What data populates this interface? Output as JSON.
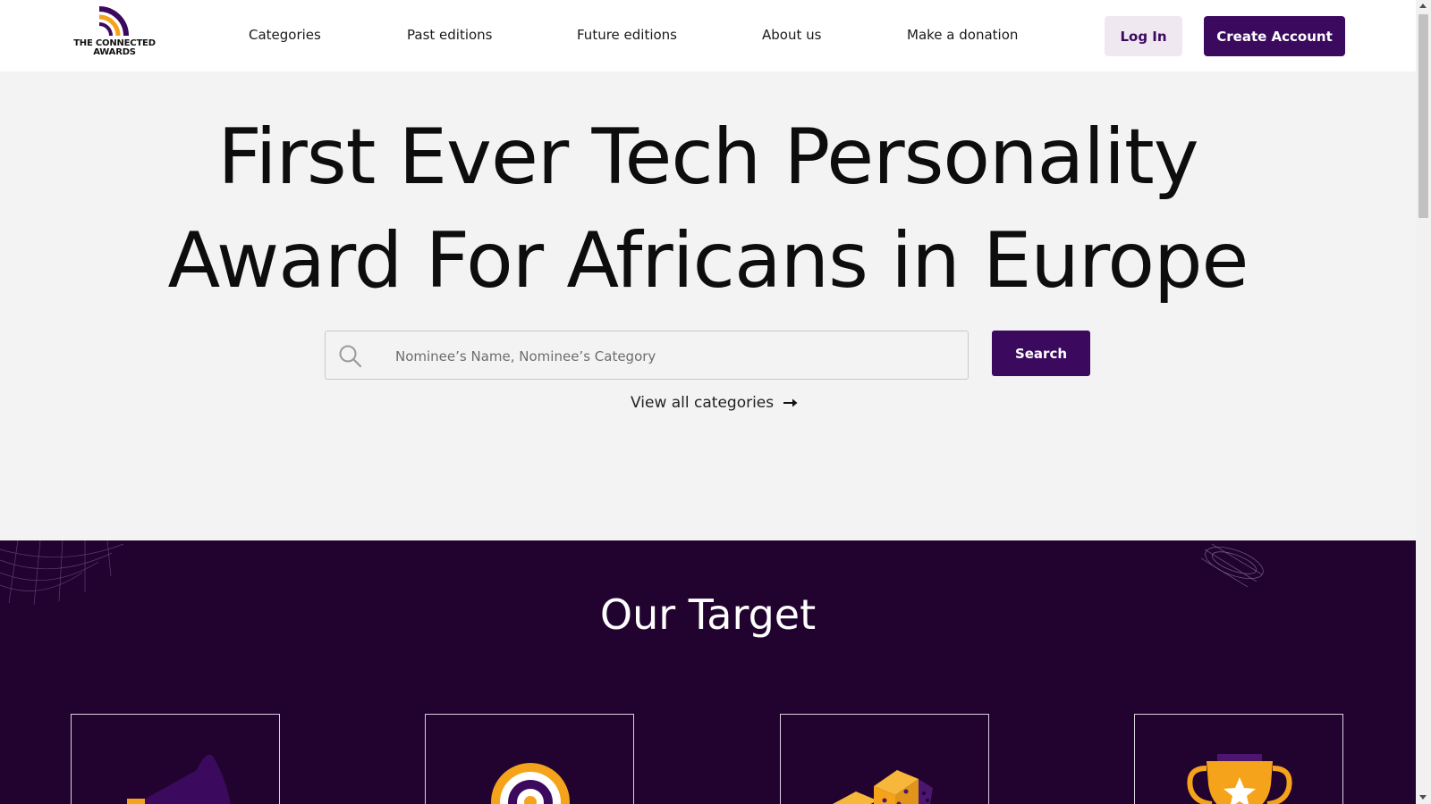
{
  "header": {
    "logo_text": "THE CONNECTED AWARDS",
    "nav": [
      "Categories",
      "Past editions",
      "Future editions",
      "About us",
      "Make a donation"
    ],
    "login_label": "Log In",
    "create_account_label": "Create Account"
  },
  "hero": {
    "title_line1": "First Ever Tech Personality",
    "title_line2": "Award For Africans in Europe",
    "search_placeholder": "Nominee’s Name, Nominee’s Category",
    "search_button_label": "Search",
    "view_all_label": "View all categories"
  },
  "target": {
    "title": "Our Target",
    "cards": [
      {
        "icon": "megaphone-icon"
      },
      {
        "icon": "target-icon"
      },
      {
        "icon": "dice-icon"
      },
      {
        "icon": "trophy-icon"
      }
    ]
  },
  "colors": {
    "brand_purple": "#3b0a5e",
    "section_dark": "#22032f",
    "accent_orange": "#f5a31a",
    "hero_bg": "#f3f3f3"
  }
}
